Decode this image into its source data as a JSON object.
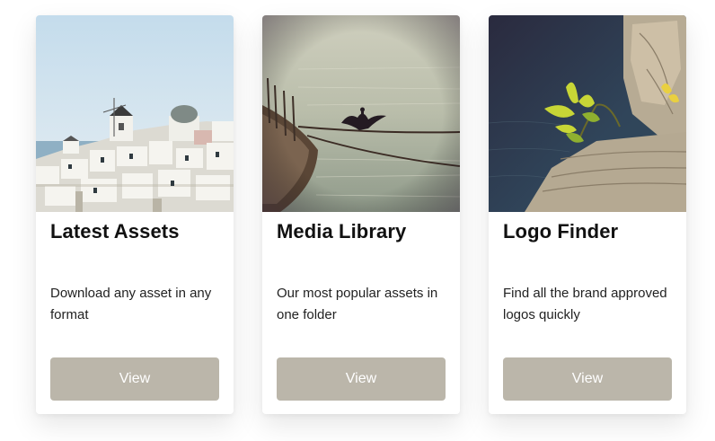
{
  "cards": [
    {
      "image": "santorini-village-photo",
      "title": "Latest Assets",
      "description": "Download any asset in any format",
      "button_label": "View"
    },
    {
      "image": "cormorant-on-rope-photo",
      "title": "Media Library",
      "description": "Our most popular assets in one folder",
      "button_label": "View"
    },
    {
      "image": "yellow-flower-on-rock-photo",
      "title": "Logo Finder",
      "description": "Find all the brand approved logos quickly",
      "button_label": "View"
    }
  ],
  "colors": {
    "button_bg": "#bbb6aa",
    "button_text": "#ffffff",
    "card_bg": "#ffffff"
  }
}
